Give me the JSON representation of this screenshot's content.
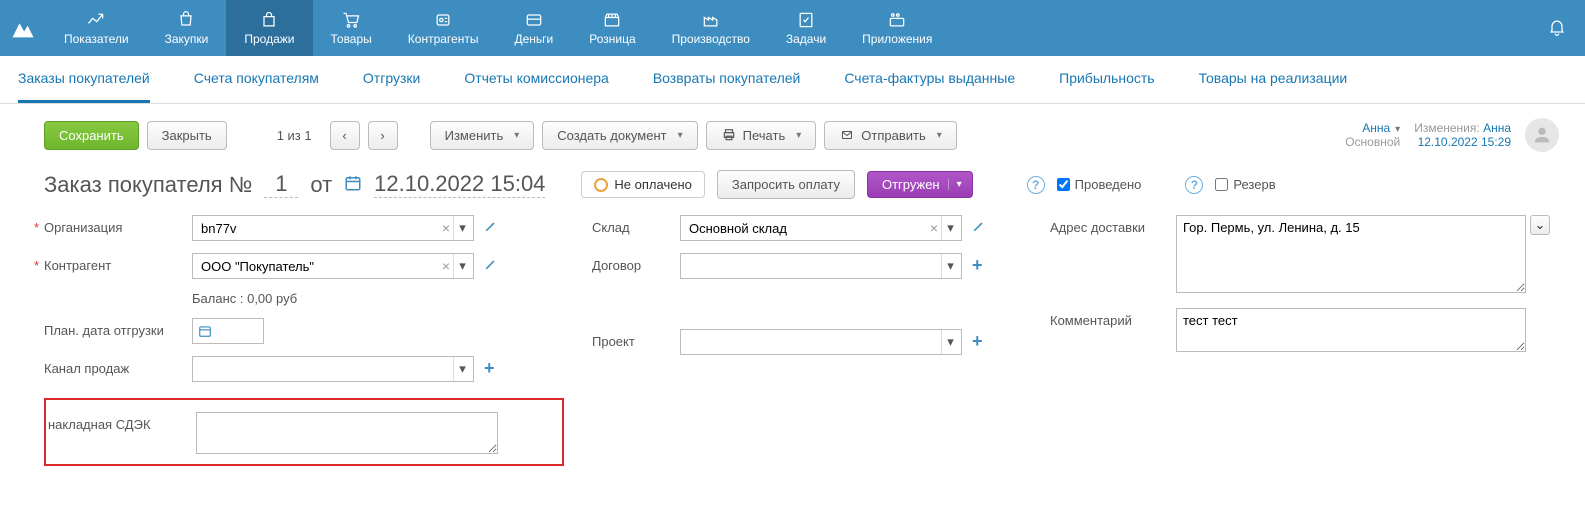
{
  "nav": {
    "items": [
      {
        "label": "Показатели"
      },
      {
        "label": "Закупки"
      },
      {
        "label": "Продажи"
      },
      {
        "label": "Товары"
      },
      {
        "label": "Контрагенты"
      },
      {
        "label": "Деньги"
      },
      {
        "label": "Розница"
      },
      {
        "label": "Производство"
      },
      {
        "label": "Задачи"
      },
      {
        "label": "Приложения"
      }
    ]
  },
  "subnav": {
    "tabs": [
      "Заказы покупателей",
      "Счета покупателям",
      "Отгрузки",
      "Отчеты комиссионера",
      "Возвраты покупателей",
      "Счета-фактуры выданные",
      "Прибыльность",
      "Товары на реализации"
    ]
  },
  "toolbar": {
    "save": "Сохранить",
    "close": "Закрыть",
    "page_count": "1 из 1",
    "change": "Изменить",
    "create_doc": "Создать документ",
    "print": "Печать",
    "send": "Отправить"
  },
  "user": {
    "name": "Анна",
    "role": "Основной",
    "changes_label": "Изменения:",
    "changes_user": "Анна",
    "changes_dt": "12.10.2022 15:29"
  },
  "doc": {
    "title": "Заказ покупателя №",
    "number": "1",
    "from_label": "от",
    "datetime": "12.10.2022 15:04",
    "pay_status": "Не оплачено",
    "request_payment": "Запросить оплату",
    "ship_status": "Отгружен",
    "posted_label": "Проведено",
    "reserve_label": "Резерв"
  },
  "form": {
    "organization_label": "Организация",
    "organization_value": "bn77v",
    "counterparty_label": "Контрагент",
    "counterparty_value": "ООО \"Покупатель\"",
    "balance": "Баланс : 0,00 руб",
    "plan_ship_label": "План. дата отгрузки",
    "sales_channel_label": "Канал продаж",
    "sdek_label": "накладная СДЭК",
    "warehouse_label": "Склад",
    "warehouse_value": "Основной склад",
    "contract_label": "Договор",
    "project_label": "Проект",
    "delivery_addr_label": "Адрес доставки",
    "delivery_addr_value": "Гор. Пермь, ул. Ленина, д. 15",
    "comment_label": "Комментарий",
    "comment_value": "тест тест"
  }
}
